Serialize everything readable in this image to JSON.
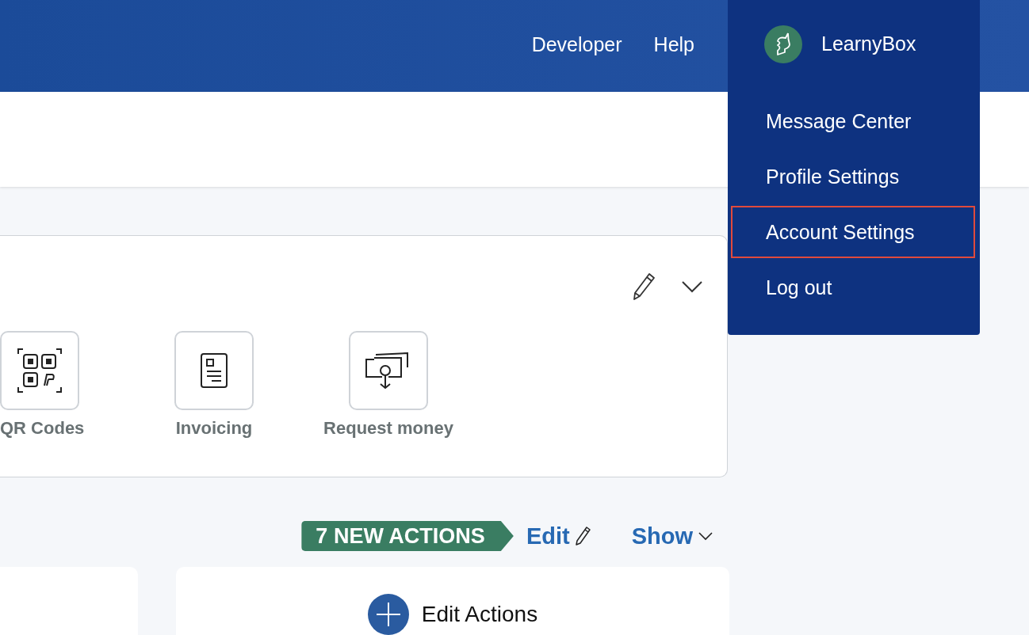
{
  "header": {
    "nav": [
      {
        "label": "Developer"
      },
      {
        "label": "Help"
      }
    ]
  },
  "account_menu": {
    "name": "LearnyBox",
    "items": [
      {
        "label": "Message Center",
        "selected": false
      },
      {
        "label": "Profile Settings",
        "selected": false
      },
      {
        "label": "Account Settings",
        "selected": true
      },
      {
        "label": "Log out",
        "selected": false
      }
    ]
  },
  "tools_card": {
    "tiles": [
      {
        "kind": "qr",
        "label": "QR Codes"
      },
      {
        "kind": "invoice",
        "label": "Invoicing"
      },
      {
        "kind": "request",
        "label": "Request money"
      }
    ]
  },
  "actions": {
    "badge": "7 NEW ACTIONS",
    "edit": "Edit",
    "show": "Show",
    "edit_actions": "Edit Actions"
  }
}
